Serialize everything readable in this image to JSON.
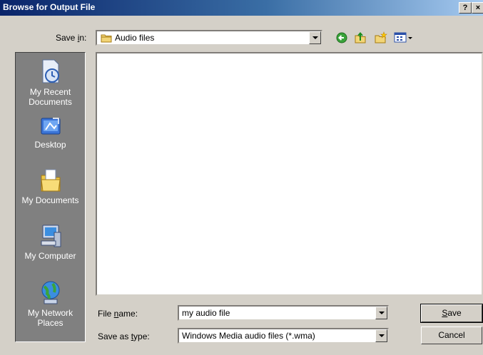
{
  "window": {
    "title": "Browse for Output File",
    "help_button": "?",
    "close_button": "×"
  },
  "save_in": {
    "label_pre": "Save ",
    "label_u": "i",
    "label_post": "n:",
    "value": "Audio files"
  },
  "toolbar": {
    "icons": [
      "back-icon",
      "up-folder-icon",
      "new-folder-icon",
      "view-menu-icon"
    ]
  },
  "places": [
    {
      "label": "My Recent\nDocuments",
      "icon": "recent-documents-icon"
    },
    {
      "label": "Desktop",
      "icon": "desktop-icon"
    },
    {
      "label": "My Documents",
      "icon": "my-documents-icon"
    },
    {
      "label": "My Computer",
      "icon": "my-computer-icon"
    },
    {
      "label": "My Network\nPlaces",
      "icon": "network-places-icon"
    }
  ],
  "file_name": {
    "label_pre": "File ",
    "label_u": "n",
    "label_post": "ame:",
    "value": "my audio file"
  },
  "save_as_type": {
    "label_pre": "Save as ",
    "label_u": "t",
    "label_post": "ype:",
    "value": "Windows Media audio files (*.wma)"
  },
  "buttons": {
    "save_u": "S",
    "save_rest": "ave",
    "cancel": "Cancel"
  }
}
